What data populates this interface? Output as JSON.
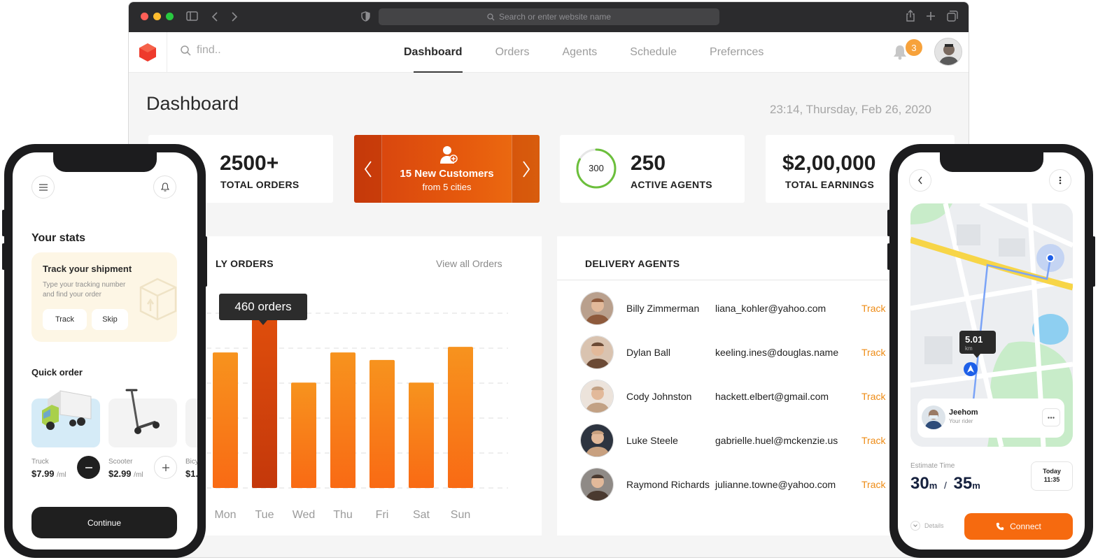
{
  "browser": {
    "url_placeholder": "Search or enter website name",
    "colors": {
      "close": "#ff5f57",
      "minimize": "#febc2e",
      "maximize": "#28c840"
    }
  },
  "nav": {
    "search_placeholder": "find..",
    "tabs": [
      {
        "label": "Dashboard",
        "active": true
      },
      {
        "label": "Orders",
        "active": false
      },
      {
        "label": "Agents",
        "active": false
      },
      {
        "label": "Schedule",
        "active": false
      },
      {
        "label": "Prefernces",
        "active": false
      }
    ],
    "notification_count": "3"
  },
  "dashboard": {
    "title": "Dashboard",
    "datetime": "23:14, Thursday, Feb 26, 2020",
    "stats": [
      {
        "value": "2500+",
        "label": "TOTAL ORDERS"
      },
      {
        "value": "250",
        "label": "ACTIVE AGENTS",
        "ring": "300",
        "ring_fraction": 0.83
      },
      {
        "value": "$2,00,000",
        "label": "TOTAL EARNINGS"
      }
    ],
    "promo": {
      "title": "15 New Customers",
      "subtitle": "from 5 cities"
    }
  },
  "orders_panel": {
    "title": "LY ORDERS",
    "view_all": "View all Orders",
    "tooltip": "460 orders"
  },
  "chart_data": {
    "type": "bar",
    "categories": [
      "Mon",
      "Tue",
      "Wed",
      "Thu",
      "Fri",
      "Sat",
      "Sun"
    ],
    "values": [
      360,
      460,
      280,
      360,
      340,
      280,
      375
    ],
    "ylim": [
      0,
      520
    ],
    "grid": true,
    "highlight_index": 1,
    "colors": {
      "bar_top": "#f7931e",
      "bar_bottom": "#f96a14",
      "highlight": "#c4380b"
    }
  },
  "agents_panel": {
    "title": "DELIVERY AGENTS",
    "agents": [
      {
        "name": "Billy Zimmerman",
        "email": "liana_kohler@yahoo.com",
        "action": "Track"
      },
      {
        "name": "Dylan Ball",
        "email": "keeling.ines@douglas.name",
        "action": "Track"
      },
      {
        "name": "Cody Johnston",
        "email": "hackett.elbert@gmail.com",
        "action": "Track"
      },
      {
        "name": "Luke Steele",
        "email": "gabrielle.huel@mckenzie.us",
        "action": "Track"
      },
      {
        "name": "Raymond Richards",
        "email": "julianne.towne@yahoo.com",
        "action": "Track"
      }
    ]
  },
  "phone_left": {
    "section_title": "Your stats",
    "track_card": {
      "title": "Track your shipment",
      "desc_line1": "Type your tracking number",
      "desc_line2": "and find your order",
      "track_btn": "Track",
      "skip_btn": "Skip"
    },
    "quick_order_title": "Quick order",
    "vehicles": [
      {
        "name": "Truck",
        "price": "$7.99",
        "unit": "/ml"
      },
      {
        "name": "Scooter",
        "price": "$2.99",
        "unit": "/ml"
      },
      {
        "name": "Bicy",
        "price": "$1.",
        "unit": ""
      }
    ],
    "continue_btn": "Continue"
  },
  "phone_right": {
    "distance": "5.01",
    "distance_unit": "km",
    "rider_name": "Jeehom",
    "rider_role": "Your rider",
    "estimate_label": "Estimate Time",
    "est_min": "30",
    "est_max": "35",
    "est_unit": "m",
    "est_sep": "/",
    "day_label": "Today",
    "time_label": "11:35",
    "details_label": "Details",
    "connect_btn": "Connect"
  }
}
